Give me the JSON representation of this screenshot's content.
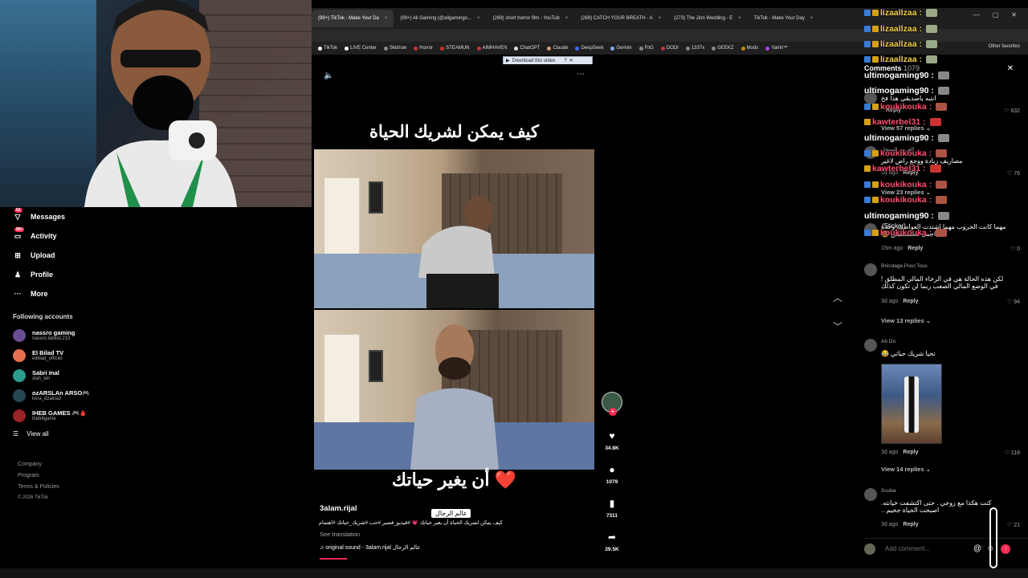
{
  "browser": {
    "tabs": [
      {
        "label": "(99+) TikTok - Make Your Da",
        "active": true
      },
      {
        "label": "(99+) Ali Gaming (@aligamingo..."
      },
      {
        "label": "(269) short horror film - YouTub"
      },
      {
        "label": "(269) CATCH YOUR BREATH - A"
      },
      {
        "label": "(273) The Jinn Wedding - E"
      },
      {
        "label": "TikTok - Make Your Day"
      }
    ],
    "bookmarks": [
      "TikTok",
      "LIVE Center",
      "Skidrow",
      "Horror",
      "STEAMUN",
      "AIMHAVEN",
      "ChatGPT",
      "Claude",
      "DeepSeek",
      "Gemini",
      "FitG",
      "DODI",
      "1337x",
      "GEEKZ",
      "Mods",
      "Yamli™"
    ],
    "other_favorites": "Other favorites",
    "download_bar": "Download this video"
  },
  "sidebar": {
    "items": [
      {
        "label": "Messages",
        "icon": "message-icon",
        "badge": "53"
      },
      {
        "label": "Activity",
        "icon": "activity-icon",
        "badge": "99+"
      },
      {
        "label": "Upload",
        "icon": "upload-icon"
      },
      {
        "label": "Profile",
        "icon": "profile-icon"
      },
      {
        "label": "More",
        "icon": "more-icon"
      }
    ],
    "following_title": "Following accounts",
    "accounts": [
      {
        "name": "nassro gaming",
        "handle": "nassro.labiod.213",
        "color": "#6a4c93"
      },
      {
        "name": "El Bilad TV",
        "handle": "elbilad_officiel",
        "color": "#e76f51"
      },
      {
        "name": "Sabri Inal",
        "handle": "slah_leh",
        "color": "#2a9d8f"
      },
      {
        "name": "ozARSLAn ARSO🎮",
        "handle": "kora_dzairia3",
        "color": "#264653"
      },
      {
        "name": "IHEB GAMES 🎮🩸",
        "handle": "iheb4game",
        "color": "#9b2226"
      }
    ],
    "view_all": "View all",
    "footer": [
      "Company",
      "Program",
      "Terms & Policies",
      "© 2026 TikTok"
    ]
  },
  "video": {
    "title": "كيف يمكن لشريك الحياة",
    "subtitle": "أن يغير حياتك",
    "heart": "❤️",
    "author": "3alam.rijal",
    "watermark": "عالم الرجال",
    "caption": "كيف يمكن لشريك الحياة أن يغير حياتك 💗 #فيديو_قصير #حب #شريك_حياتك #اهتمام",
    "see_translation": "See translation",
    "sound": "original sound - 3alam.rijal عالم الرجال"
  },
  "actions": {
    "likes": "34.8K",
    "comments": "1079",
    "saves": "7311",
    "shares": "29.5K"
  },
  "comments_panel": {
    "title": "Comments",
    "count": "1079",
    "comments": [
      {
        "user": "",
        "text": "انتبه ياصديقي هذا فخ",
        "time": "",
        "reply": "Reply",
        "likes": "632",
        "view_replies": "View 57 replies"
      },
      {
        "user": "الغريب المنتحل",
        "text": "مصاريف زيادة ووجع راص لاغير",
        "time": "1d ago",
        "reply": "Reply",
        "likes": "76",
        "view_replies": "View 23 replies"
      },
      {
        "user": "",
        "text": "مهما كانت الحروب مهما اشتدت العواصف وحدة اجمل مشمشيش 😂",
        "time": "15m ago",
        "reply": "Reply",
        "likes": "0"
      },
      {
        "user": "Bricolage.Pour.Tous",
        "text": "لكن هذه الحالة هي في الرخاء المالي المطلق ! في الوضع المالي الصعب ربما لن تكون كذلك",
        "time": "3d ago",
        "reply": "Reply",
        "likes": "94",
        "view_replies": "View 13 replies"
      },
      {
        "user": "Ab Do",
        "text": "تحيا شريك حياتي 😂",
        "time": "3d ago",
        "reply": "Reply",
        "likes": "118",
        "view_replies": "View 14 replies"
      },
      {
        "user": "Scuba",
        "text": "كنت هكذا مع زوجي . حتى اكتشفت خيانته. اصبحت الحياة جحيم ..",
        "time": "3d ago",
        "reply": "Reply",
        "likes": "21"
      }
    ],
    "add_placeholder": "Add comment..."
  },
  "chat": [
    {
      "user": "lizaallzaa :",
      "color": "#f5d142"
    },
    {
      "user": "lizaallzaa :",
      "color": "#f5d142"
    },
    {
      "user": "lizaallzaa :",
      "color": "#f5d142"
    },
    {
      "user": "lizaallzaa :",
      "color": "#f5d142"
    },
    {
      "user": "ultimogaming90 :",
      "color": "#ffffff"
    },
    {
      "user": "ultimogaming90 :",
      "color": "#ffffff"
    },
    {
      "user": "koukikouka :",
      "color": "#ff4d6d"
    },
    {
      "user": "kawterbel31 :",
      "color": "#ff4d6d"
    },
    {
      "user": "ultimogaming90 :",
      "color": "#ffffff"
    },
    {
      "user": "koukikouka :",
      "color": "#ff4d6d"
    },
    {
      "user": "kawterbel31 :",
      "color": "#ff4d6d"
    },
    {
      "user": "koukikouka :",
      "color": "#ff4d6d"
    },
    {
      "user": "koukikouka :",
      "color": "#ff4d6d"
    },
    {
      "user": "ultimogaming90 :",
      "color": "#ffffff"
    },
    {
      "user": "koukikouka :",
      "color": "#ff4d6d"
    }
  ],
  "chat_sticker": "(Sticker)",
  "colors": {
    "accent": "#fe2c55"
  }
}
